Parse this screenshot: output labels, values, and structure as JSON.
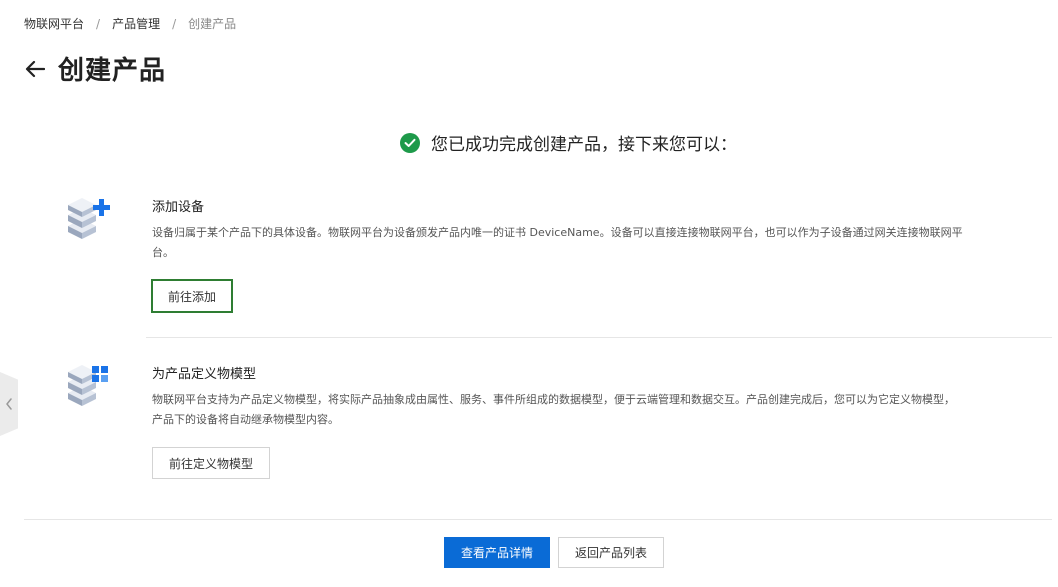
{
  "breadcrumb": {
    "items": [
      "物联网平台",
      "产品管理",
      "创建产品"
    ],
    "separator": "/"
  },
  "page": {
    "title": "创建产品"
  },
  "success": {
    "message": "您已成功完成创建产品，接下来您可以："
  },
  "sections": [
    {
      "title": "添加设备",
      "desc_line1": "设备归属于某个产品下的具体设备。物联网平台为设备颁发产品内唯一的证书 DeviceName。设备可以直接连接物联网平台，也可以作为子设备通过网关连接物联网平",
      "desc_line2": "台。",
      "button": "前往添加"
    },
    {
      "title": "为产品定义物模型",
      "desc_line1": "物联网平台支持为产品定义物模型，将实际产品抽象成由属性、服务、事件所组成的数据模型，便于云端管理和数据交互。产品创建完成后，您可以为它定义物模型，",
      "desc_line2": "产品下的设备将自动继承物模型内容。",
      "button": "前往定义物模型"
    }
  ],
  "footer": {
    "primary_button": "查看产品详情",
    "secondary_button": "返回产品列表"
  },
  "colors": {
    "primary": "#0a6bd6",
    "success": "#1e9a4a",
    "highlight_border": "#2e7d32",
    "icon_accent": "#1a73e8"
  },
  "icons": {
    "back": "arrow-left-icon",
    "success": "check-circle-icon",
    "add_device": "device-stack-plus-icon",
    "thing_model": "device-stack-grid-icon",
    "side": "chevron-left-icon"
  }
}
